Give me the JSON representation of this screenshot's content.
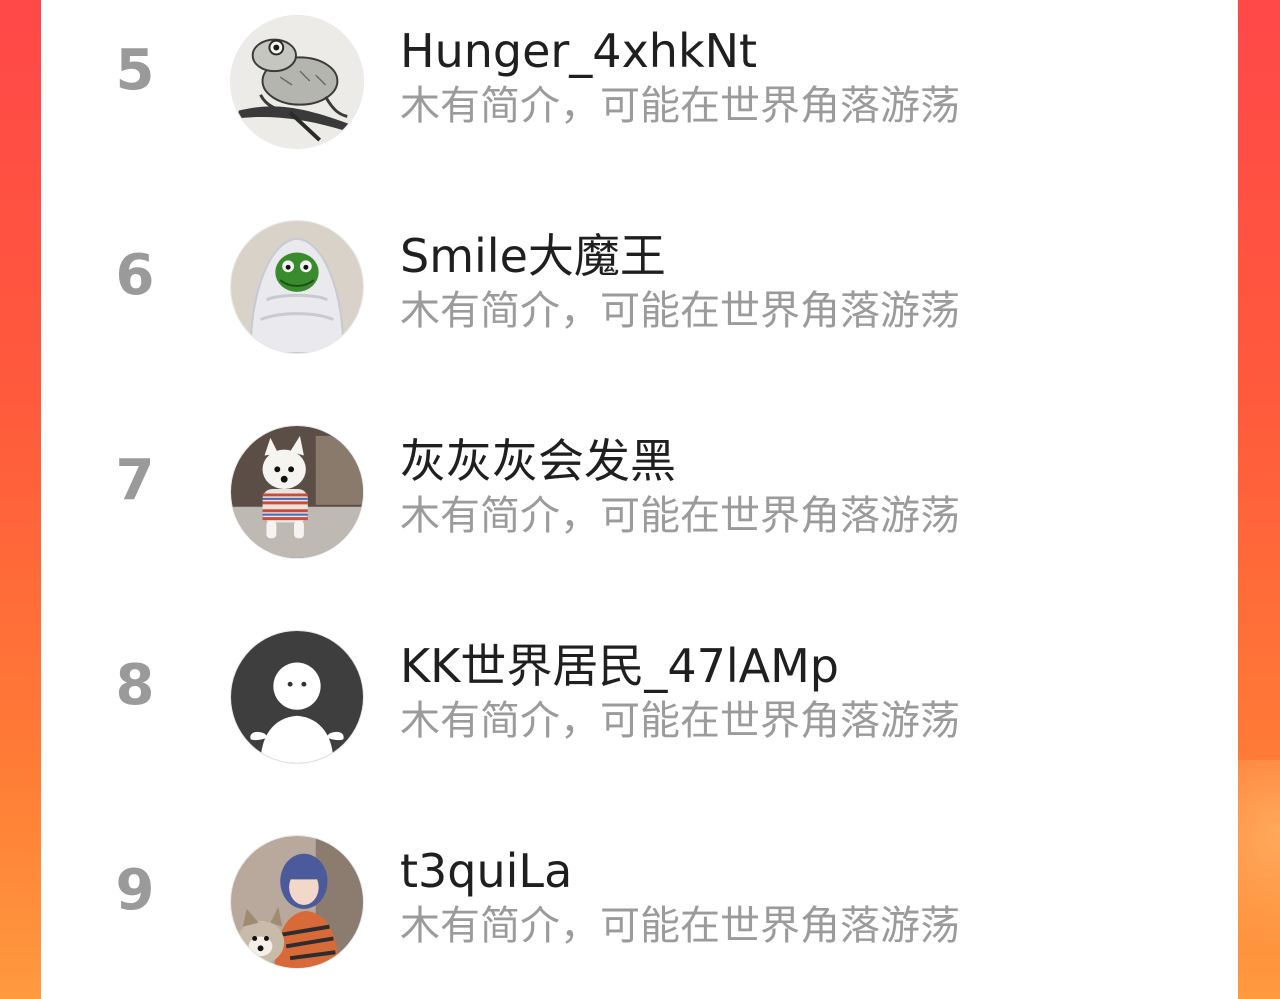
{
  "ranking": {
    "items": [
      {
        "rank": "5",
        "name": "Hunger_4xhkNt",
        "bio": "木有简介，可能在世界角落游荡",
        "avatar_icon": "frog-sketch-avatar"
      },
      {
        "rank": "6",
        "name": "Smile大魔王",
        "bio": "木有简介，可能在世界角落游荡",
        "avatar_icon": "frog-blanket-avatar"
      },
      {
        "rank": "7",
        "name": "灰灰灰会发黑",
        "bio": "木有简介，可能在世界角落游荡",
        "avatar_icon": "white-dog-avatar"
      },
      {
        "rank": "8",
        "name": "KK世界居民_47lAMp",
        "bio": "木有简介，可能在世界角落游荡",
        "avatar_icon": "default-user-avatar"
      },
      {
        "rank": "9",
        "name": "t3quiLa",
        "bio": "木有简介，可能在世界角落游荡",
        "avatar_icon": "girl-with-dog-avatar"
      }
    ]
  },
  "colors": {
    "background_top": "#ff4848",
    "background_bottom": "#ff9a3e",
    "panel": "#ffffff",
    "rank_text": "#9a9a9a",
    "name_text": "#1f1f1f",
    "bio_text": "#9b9b9b"
  }
}
